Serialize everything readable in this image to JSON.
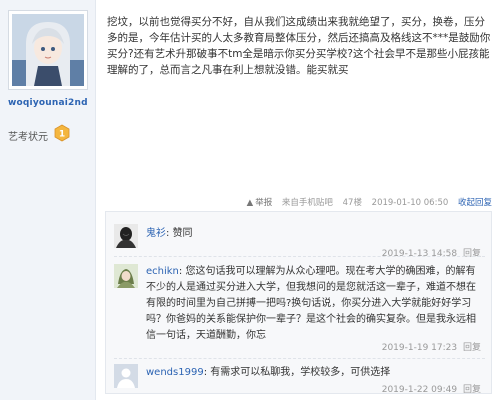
{
  "user": {
    "name": "woqiyounai2nd",
    "achievement_label": "艺考状元",
    "badge_value": "1"
  },
  "post": {
    "text": "挖坟，以前也觉得买分不好，自从我们这成绩出来我就绝望了，买分，换卷，压分多的是，今年估计买的人太多教育局整体压分，然后还搞高及格线这不***是鼓励你买分?还有艺术升那破事不tm全是暗示你买分买学校?这个社会早不是那些小屁孩能理解的了，总而言之凡事在利上想就没错。能买就买",
    "report": "举报",
    "source": "来自手机贴吧",
    "floor": "47楼",
    "time": "2019-01-10 06:50",
    "collapse": "收起回复"
  },
  "replies": [
    {
      "user": "鬼衫",
      "text": "赞同",
      "time": "2019-1-13 14:58",
      "reply_label": "回复"
    },
    {
      "user": "echikn",
      "text": "您这句话我可以理解为从众心理吧。现在考大学的确困难，的解有不少的人是通过买分进入大学，但我想问的是您就活这一辈子，难道不想在有限的时间里为自己拼搏一把吗?换句话说，你买分进入大学就能好好学习吗？你爸妈的关系能保护你一辈子？是这个社会的确实复杂。但是我永远相信一句话，天道酬勤，你忘",
      "time": "2019-1-19 17:23",
      "reply_label": "回复"
    },
    {
      "user": "wends1999",
      "text": "有需求可以私聊我，学校较多，可供选择",
      "time": "2019-1-22 09:49",
      "reply_label": "回复"
    }
  ]
}
